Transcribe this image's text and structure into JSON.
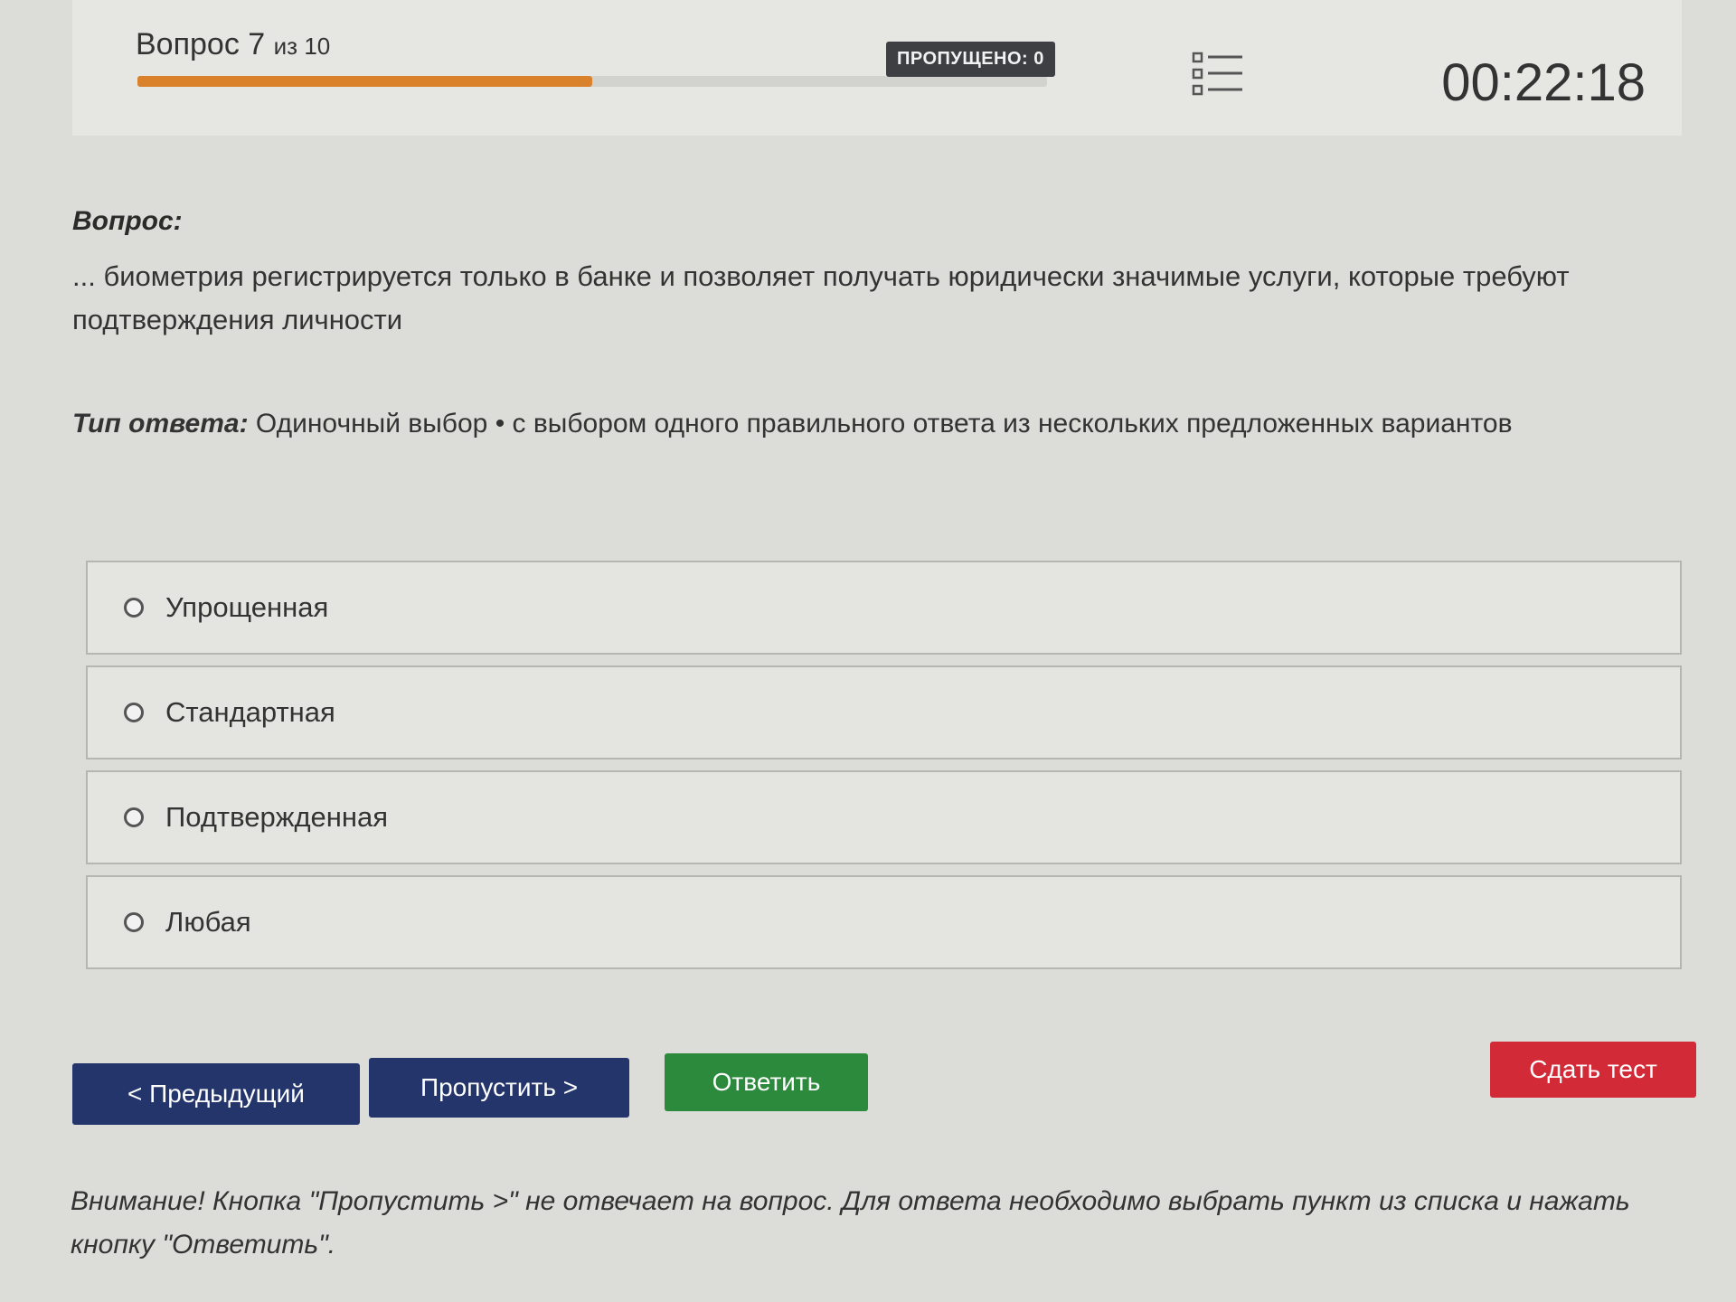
{
  "header": {
    "question_word": "Вопрос",
    "question_number": "7",
    "question_of": "из 10",
    "progress_fraction": 0.5,
    "skipped_badge": "ПРОПУЩЕНО: 0",
    "timer": "00:22:18",
    "list_icon": "list-icon"
  },
  "question": {
    "heading": "Вопрос:",
    "text": "... биометрия регистрируется только в банке и позволяет получать юридически значимые услуги, которые требуют подтверждения личности"
  },
  "answer_type": {
    "label": "Тип ответа:",
    "value": "Одиночный выбор • с выбором одного правильного ответа из нескольких предложенных вариантов"
  },
  "options": [
    {
      "label": "Упрощенная"
    },
    {
      "label": "Стандартная"
    },
    {
      "label": "Подтвержденная"
    },
    {
      "label": "Любая"
    }
  ],
  "buttons": {
    "prev": "< Предыдущий",
    "skip": "Пропустить >",
    "answer": "Ответить",
    "submit": "Сдать тест"
  },
  "colors": {
    "progress": "#d9822b",
    "primary_button": "#23356b",
    "answer_button": "#2c8a3c",
    "submit_button": "#d22a36"
  },
  "warning": "Внимание! Кнопка \"Пропустить >\" не отвечает на вопрос. Для ответа необходимо выбрать пункт из списка и нажать кнопку \"Ответить\"."
}
